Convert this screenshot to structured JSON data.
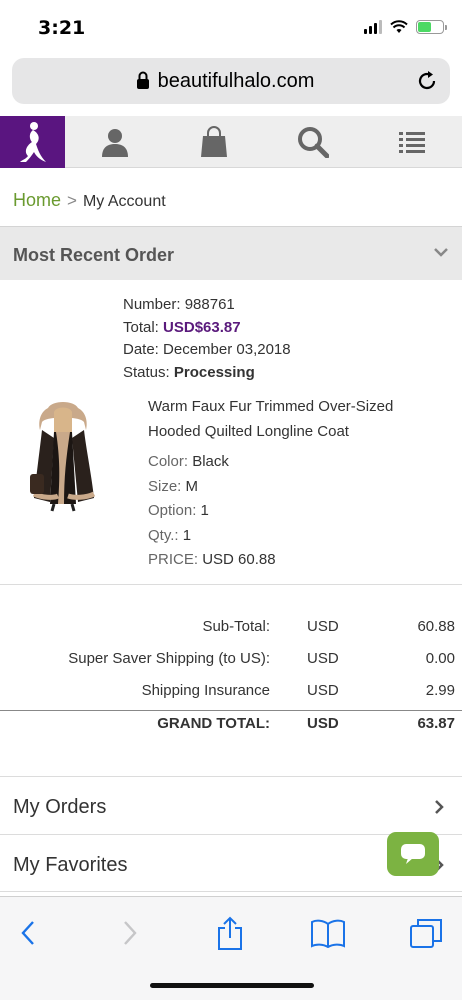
{
  "status_bar": {
    "time": "3:21"
  },
  "browser": {
    "url": "beautifulhalo.com"
  },
  "breadcrumb": {
    "home": "Home",
    "separator": ">",
    "current": "My Account"
  },
  "section": {
    "title": "Most Recent Order"
  },
  "order": {
    "number_label": "Number:",
    "number": "988761",
    "total_label": "Total:",
    "total": "USD$63.87",
    "date_label": "Date:",
    "date": "December 03,2018",
    "status_label": "Status:",
    "status": "Processing"
  },
  "product": {
    "name_line1": "Warm Faux Fur Trimmed Over-Sized",
    "name_line2": "Hooded Quilted Longline Coat",
    "color_label": "Color:",
    "color": "Black",
    "size_label": "Size:",
    "size": "M",
    "option_label": "Option:",
    "option": "1",
    "qty_label": "Qty.:",
    "qty": "1",
    "price_label": "PRICE:",
    "price": "USD 60.88"
  },
  "totals": {
    "subtotal": {
      "label": "Sub-Total:",
      "currency": "USD",
      "amount": "60.88"
    },
    "shipping": {
      "label": "Super Saver Shipping (to US):",
      "currency": "USD",
      "amount": "0.00"
    },
    "insurance": {
      "label": "Shipping Insurance",
      "currency": "USD",
      "amount": "2.99"
    },
    "grand": {
      "label": "GRAND TOTAL:",
      "currency": "USD",
      "amount": "63.87"
    }
  },
  "menu": {
    "orders": "My Orders",
    "favorites": "My Favorites"
  },
  "colors": {
    "brand_purple": "#5a1580",
    "link_green": "#6a9a2f",
    "chat_green": "#7cb342",
    "ios_blue": "#1a73e8"
  },
  "icons": [
    "lock-icon",
    "reload-icon",
    "user-icon",
    "bag-icon",
    "search-icon",
    "menu-icon",
    "chat-icon",
    "back-icon",
    "forward-icon",
    "share-icon",
    "bookmarks-icon",
    "tabs-icon"
  ]
}
